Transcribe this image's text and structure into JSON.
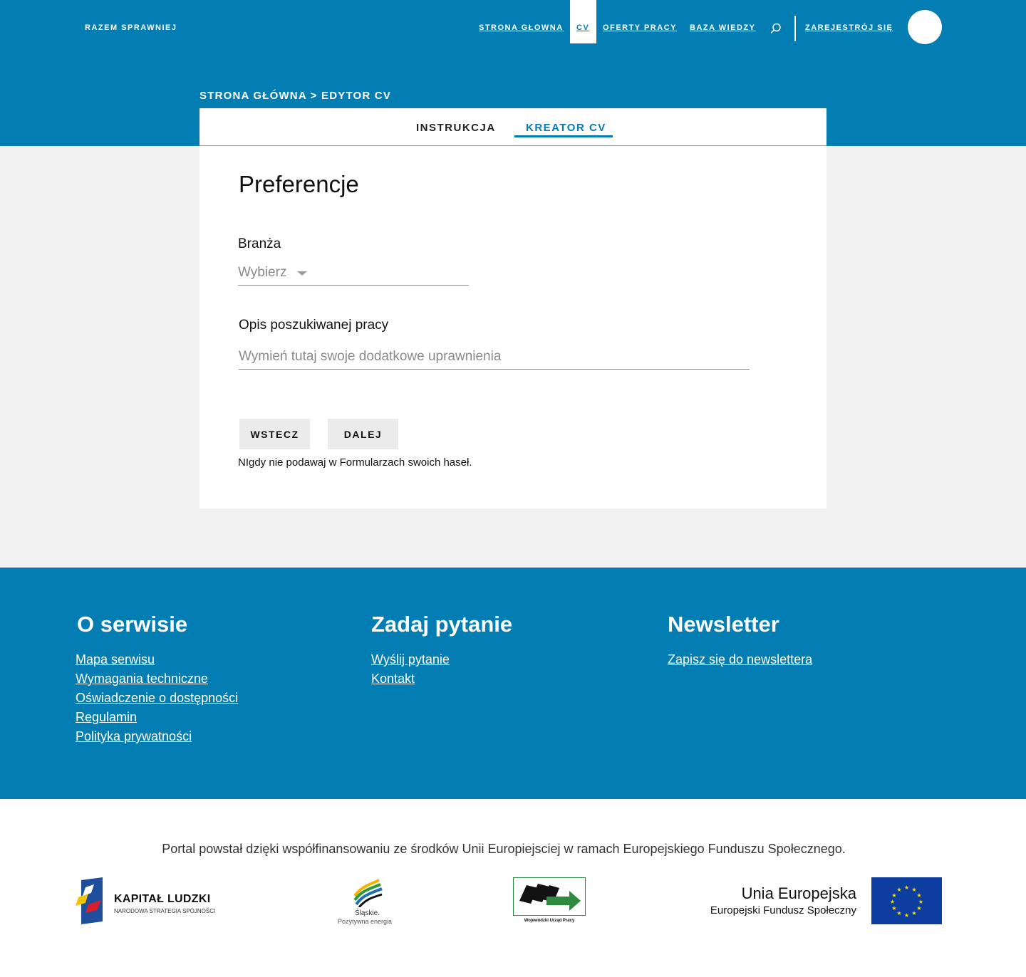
{
  "header": {
    "brand": "RAZEM SPRAWNIEJ",
    "nav": {
      "home": "STRONA GŁOWNA",
      "cv": "CV",
      "offers": "OFERTY PRACY",
      "knowledge": "BAZA WIEDZY",
      "register": "ZAREJESTRÓJ SIĘ"
    },
    "search_icon": "search-icon"
  },
  "breadcrumb": "STRONA GŁÓWNA > EDYTOR CV",
  "tabs": [
    {
      "label": "INSTRUKCJA",
      "active": false
    },
    {
      "label": "KREATOR CV",
      "active": true
    }
  ],
  "form": {
    "title": "Preferencje",
    "branza_label": "Branża",
    "branza_value": "Wybierz",
    "opis_label": "Opis poszukiwanej pracy",
    "opis_placeholder": "Wymień tutaj swoje dodatkowe uprawnienia",
    "opis_value": "",
    "back_button": "WSTECZ",
    "next_button": "DALEJ",
    "note": "NIgdy nie podawaj w Formularzach swoich haseł."
  },
  "footer": {
    "columns": [
      {
        "title": "O serwisie",
        "links": [
          "Mapa serwisu",
          "Wymagania techniczne",
          "Oświadczenie o dostępności",
          "Regulamin",
          "Polityka prywatności"
        ]
      },
      {
        "title": "Zadaj pytanie",
        "links": [
          "Wyślij pytanie",
          "Kontakt"
        ]
      },
      {
        "title": "Newsletter",
        "links": [
          "Zapisz się do newslettera"
        ]
      }
    ]
  },
  "funding": {
    "text": "Portal powstał dzięki współfinansowaniu ze środków Unii Europiejsciej w ramach Europejskiego Funduszu Społecznego.",
    "logos": {
      "kl_title": "KAPITAŁ LUDZKI",
      "kl_sub": "NARODOWA STRATEGIA SPÓJNOŚCI",
      "sl_title": "Śląskie.",
      "sl_sub": "Pozytywna energia",
      "wup_title": "Wojewódzki Urząd Pracy",
      "ue_title": "Unia Europejska",
      "ue_sub": "Europejski Fundusz Społeczny"
    }
  },
  "colors": {
    "primary": "#047db2",
    "background": "#f2f2f2",
    "button_bg": "#ebebeb"
  }
}
